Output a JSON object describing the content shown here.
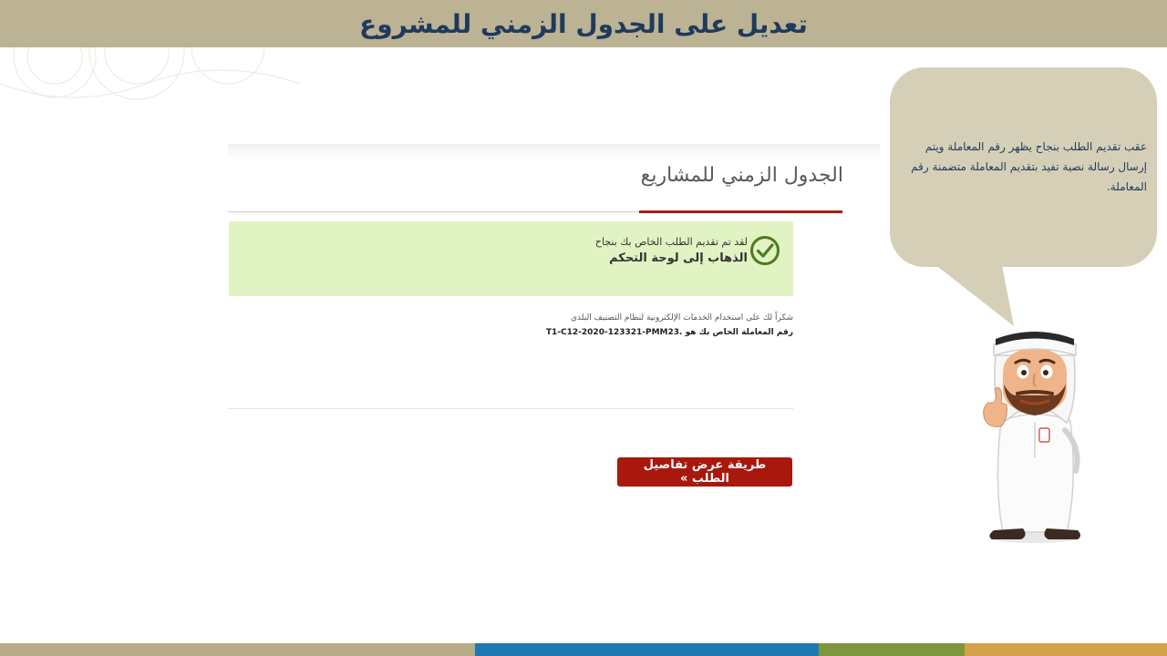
{
  "banner": {
    "title": "تعديل على الجدول الزمني للمشروع"
  },
  "page": {
    "heading": "الجدول الزمني للمشاريع",
    "success": {
      "message": "لقد تم تقديم الطلب الخاص بك بنجاح",
      "dashboard_link": "الذهاب إلى لوحة التحكم"
    },
    "thanks_text": "شكراً لك على استخدام الخدمات الإلكترونية لنظام التصنيف البلدي",
    "transaction_label": "رقم المعاملة الخاص بك هو",
    "transaction_number": "T1-C12-2020-123321-PMM23.",
    "details_button": "طريقة عرض تفاصيل الطلب »"
  },
  "callout": {
    "text": "عقب تقديم الطلب بنجاح يظهر رقم المعاملة ويتم إرسال رسالة نصية تفيد بتقديم المعاملة متضمنة رقم المعاملة."
  },
  "icons": {
    "check": "check-circle-icon",
    "mascot": "mascot-character"
  },
  "colors": {
    "banner": "#bcb294",
    "title": "#1f3a5c",
    "accent_red": "#a61f0f",
    "success_bg": "#e1f3c2",
    "check_green": "#4e7a22",
    "bubble": "#d6cfb8",
    "footer": [
      "#b8ab8a",
      "#1f78b2",
      "#7e963c",
      "#d4a24a"
    ]
  }
}
